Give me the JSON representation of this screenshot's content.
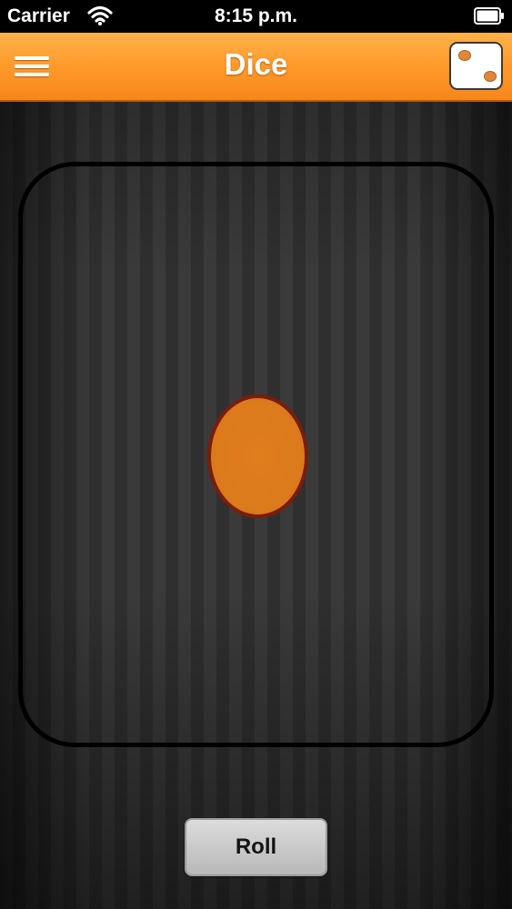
{
  "status_bar": {
    "carrier": "Carrier",
    "time": "8:15 p.m.",
    "icons": [
      "wifi-icon",
      "battery-icon"
    ]
  },
  "nav_bar": {
    "title": "Dice",
    "left_icon": "menu-icon",
    "right_icon": "die-two-icon"
  },
  "dice": {
    "value": 1,
    "pip_color": "#db7a1c",
    "pip_outline_color": "#7a1d0a"
  },
  "actions": {
    "roll_label": "Roll"
  },
  "colors": {
    "accent": "#ff9a2a",
    "status_bar": "#000000"
  }
}
